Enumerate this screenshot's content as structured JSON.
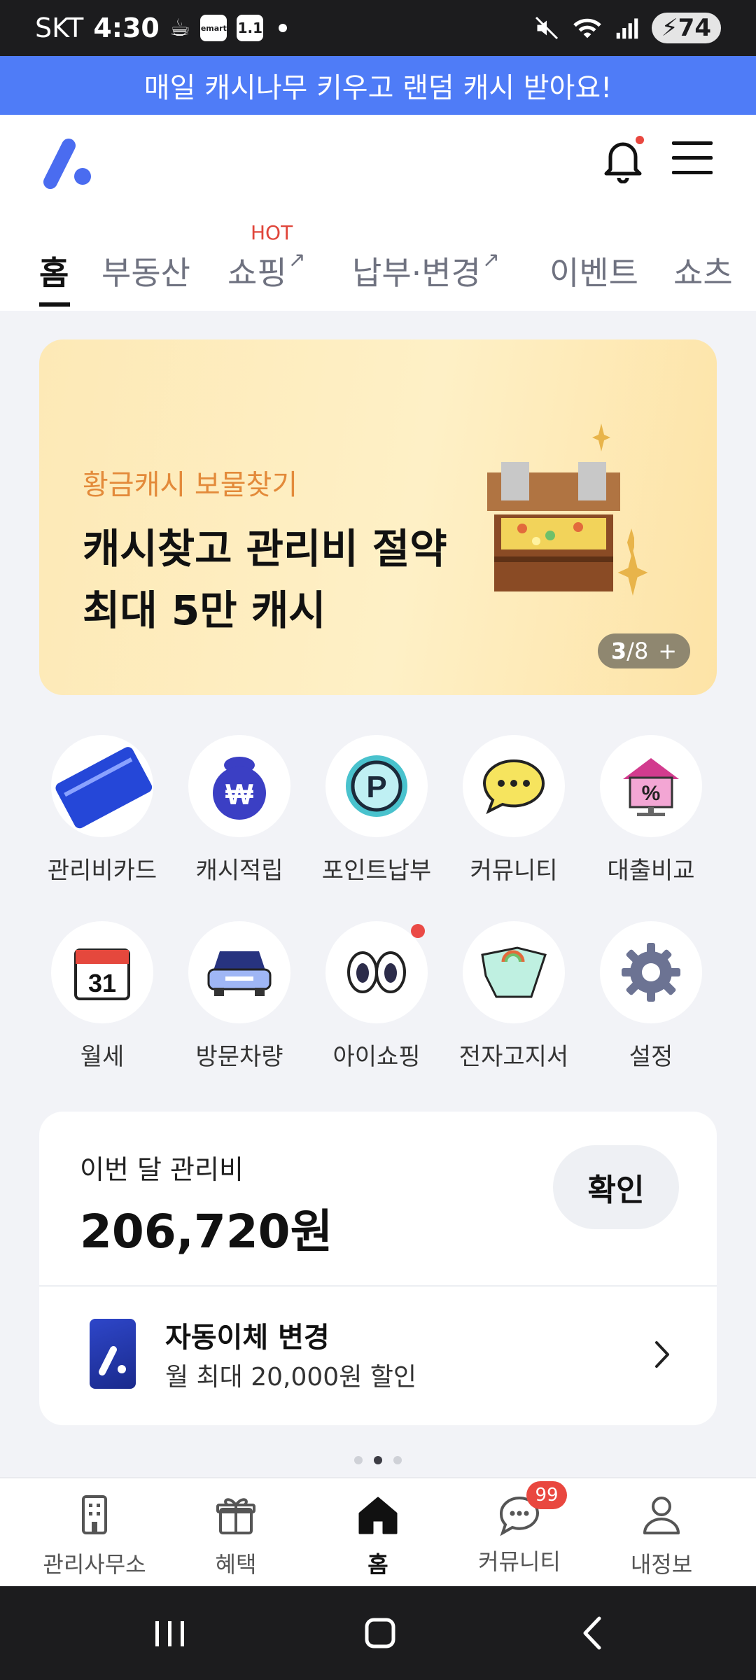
{
  "status_bar": {
    "carrier": "SKT",
    "time": "4:30",
    "mini_icons": [
      "emart",
      "1.1"
    ],
    "battery": "74"
  },
  "promo_banner": {
    "text": "매일 캐시나무 키우고 랜덤 캐시 받아요!"
  },
  "tabs": [
    {
      "label": "홈",
      "active": true
    },
    {
      "label": "부동산"
    },
    {
      "label": "쇼핑",
      "external": true,
      "badge": "HOT"
    },
    {
      "label": "납부·변경",
      "external": true
    },
    {
      "label": "이벤트"
    },
    {
      "label": "쇼츠"
    }
  ],
  "hero": {
    "subtitle": "황금캐시 보물찾기",
    "title_line1": "캐시찾고 관리비 절약",
    "title_line2": "최대 5만 캐시",
    "counter_current": "3",
    "counter_total": "/8",
    "counter_plus": "+"
  },
  "shortcuts": [
    {
      "label": "관리비카드",
      "icon": "card-icon"
    },
    {
      "label": "캐시적립",
      "icon": "money-bag-icon"
    },
    {
      "label": "포인트납부",
      "icon": "point-coin-icon"
    },
    {
      "label": "커뮤니티",
      "icon": "chat-bubble-icon"
    },
    {
      "label": "대출비교",
      "icon": "loan-house-icon"
    },
    {
      "label": "월세",
      "icon": "calendar-icon",
      "calendar_day": "31"
    },
    {
      "label": "방문차량",
      "icon": "car-icon"
    },
    {
      "label": "아이쇼핑",
      "icon": "eyes-icon",
      "has_dot": true
    },
    {
      "label": "전자고지서",
      "icon": "bill-icon"
    },
    {
      "label": "설정",
      "icon": "gear-icon"
    }
  ],
  "fee": {
    "title": "이번 달 관리비",
    "amount": "206,720원",
    "confirm_label": "확인",
    "auto_title": "자동이체 변경",
    "auto_subtitle": "월 최대 20,000원 할인"
  },
  "pager": {
    "count": 3,
    "active": 2
  },
  "bottom_nav": [
    {
      "label": "관리사무소",
      "icon": "building-icon"
    },
    {
      "label": "혜택",
      "icon": "gift-icon"
    },
    {
      "label": "홈",
      "icon": "home-icon",
      "active": true
    },
    {
      "label": "커뮤니티",
      "icon": "community-chat-icon",
      "badge": "99"
    },
    {
      "label": "내정보",
      "icon": "person-icon"
    }
  ],
  "colors": {
    "banner": "#4f7cf7",
    "accent_orange": "#e38a3a",
    "hot_red": "#e0453a",
    "badge_red": "#e9473f"
  }
}
